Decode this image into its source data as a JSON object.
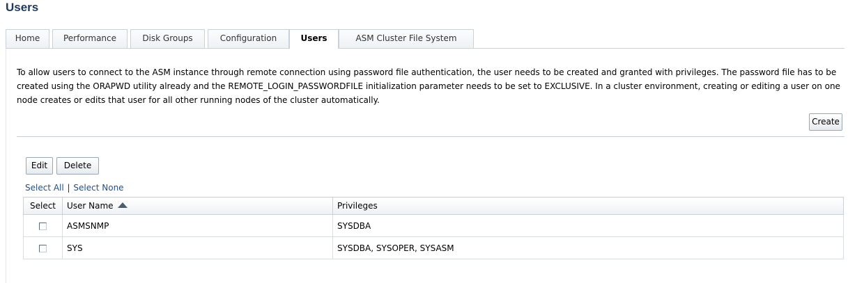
{
  "page": {
    "title": "Users"
  },
  "tabs": [
    {
      "label": "Home",
      "active": false
    },
    {
      "label": "Performance",
      "active": false
    },
    {
      "label": "Disk Groups",
      "active": false
    },
    {
      "label": "Configuration",
      "active": false
    },
    {
      "label": "Users",
      "active": true
    },
    {
      "label": "ASM Cluster File System",
      "active": false
    }
  ],
  "intro": {
    "text": "To allow users to connect to the ASM instance through remote connection using password file authentication, the user needs to be created and granted with privileges. The password file has to be created using the ORAPWD utility already and the REMOTE_LOGIN_PASSWORDFILE initialization parameter needs to be set to EXCLUSIVE. In a cluster environment, creating or editing a user on one node creates or edits that user for all other running nodes of the cluster automatically."
  },
  "actions": {
    "create_label": "Create",
    "edit_label": "Edit",
    "delete_label": "Delete"
  },
  "selection": {
    "select_all": "Select All",
    "separator": "|",
    "select_none": "Select None"
  },
  "table": {
    "headers": {
      "select": "Select",
      "user_name": "User Name",
      "privileges": "Privileges"
    },
    "sort": {
      "column": "User Name",
      "direction": "ascending",
      "icon": "sort-ascending-icon"
    },
    "rows": [
      {
        "user_name": "ASMSNMP",
        "privileges": "SYSDBA",
        "selected": false
      },
      {
        "user_name": "SYS",
        "privileges": "SYSDBA, SYSOPER, SYSASM",
        "selected": false
      }
    ]
  },
  "colors": {
    "title": "#1f3a5f",
    "link": "#1e4f8c",
    "border": "#c9d2da"
  }
}
